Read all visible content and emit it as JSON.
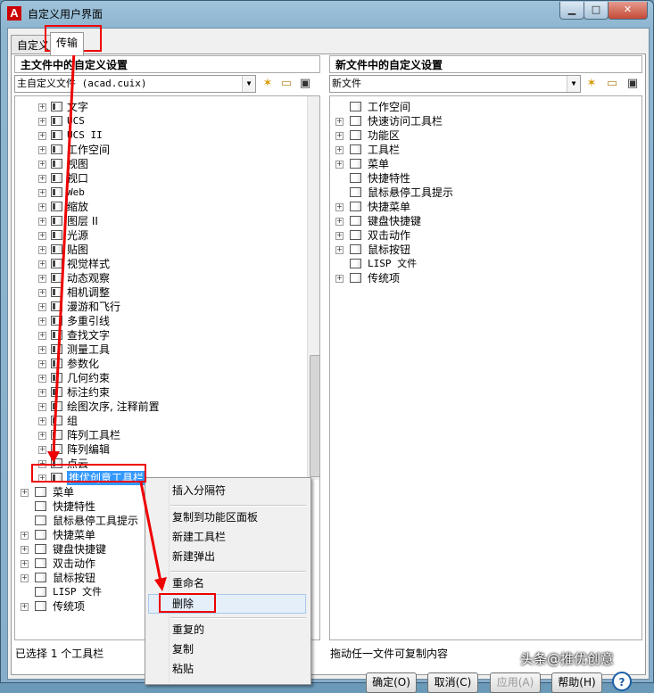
{
  "window": {
    "title": "自定义用户界面",
    "app_icon": "A",
    "minimize": "▁",
    "maximize": "□",
    "close": "✕"
  },
  "tabs": [
    "自定义",
    "传输"
  ],
  "left": {
    "header": "主文件中的自定义设置",
    "combo": "主自定义文件 (acad.cuix)",
    "tree": [
      {
        "label": "文字",
        "mono": false
      },
      {
        "label": "UCS",
        "mono": true
      },
      {
        "label": "UCS II",
        "mono": true
      },
      {
        "label": "工作空间",
        "mono": false
      },
      {
        "label": "视图",
        "mono": false
      },
      {
        "label": "视口",
        "mono": false
      },
      {
        "label": "Web",
        "mono": true
      },
      {
        "label": "缩放",
        "mono": false
      },
      {
        "label": "图层 II",
        "mono": false
      },
      {
        "label": "光源",
        "mono": false
      },
      {
        "label": "贴图",
        "mono": false
      },
      {
        "label": "视觉样式",
        "mono": false
      },
      {
        "label": "动态观察",
        "mono": false
      },
      {
        "label": "相机调整",
        "mono": false
      },
      {
        "label": "漫游和飞行",
        "mono": false
      },
      {
        "label": "多重引线",
        "mono": false
      },
      {
        "label": "查找文字",
        "mono": false
      },
      {
        "label": "测量工具",
        "mono": false
      },
      {
        "label": "参数化",
        "mono": false
      },
      {
        "label": "几何约束",
        "mono": false
      },
      {
        "label": "标注约束",
        "mono": false
      },
      {
        "label": "绘图次序, 注释前置",
        "mono": false
      },
      {
        "label": "组",
        "mono": false
      },
      {
        "label": "阵列工具栏",
        "mono": false
      },
      {
        "label": "阵列编辑",
        "mono": false
      },
      {
        "label": "点云",
        "mono": false
      },
      {
        "label": "推优创意工具栏",
        "mono": false,
        "selected": true
      }
    ],
    "tree_root": [
      {
        "label": "菜单",
        "icon": "menu-icon",
        "expander": true
      },
      {
        "label": "快捷特性",
        "icon": "quick-properties-icon",
        "expander": false
      },
      {
        "label": "鼠标悬停工具提示",
        "icon": "rollover-tooltip-icon",
        "expander": false
      },
      {
        "label": "快捷菜单",
        "icon": "shortcut-menu-icon",
        "expander": true
      },
      {
        "label": "键盘快捷键",
        "icon": "keyboard-icon",
        "expander": true
      },
      {
        "label": "双击动作",
        "icon": "double-click-icon",
        "expander": true
      },
      {
        "label": "鼠标按钮",
        "icon": "mouse-icon",
        "expander": true
      },
      {
        "label": "LISP 文件",
        "icon": "lisp-icon",
        "expander": false
      },
      {
        "label": "传统项",
        "icon": "legacy-icon",
        "expander": true
      }
    ],
    "status": "已选择 1 个工具栏"
  },
  "right": {
    "header": "新文件中的自定义设置",
    "combo": "新文件",
    "tree": [
      {
        "label": "工作空间",
        "icon": "gear-icon",
        "expander": false
      },
      {
        "label": "快速访问工具栏",
        "icon": "qat-icon",
        "expander": true
      },
      {
        "label": "功能区",
        "icon": "ribbon-icon",
        "expander": true
      },
      {
        "label": "工具栏",
        "icon": "toolbar-icon",
        "expander": true
      },
      {
        "label": "菜单",
        "icon": "menu-icon",
        "expander": true
      },
      {
        "label": "快捷特性",
        "icon": "quick-properties-icon",
        "expander": false
      },
      {
        "label": "鼠标悬停工具提示",
        "icon": "rollover-tooltip-icon",
        "expander": false
      },
      {
        "label": "快捷菜单",
        "icon": "shortcut-menu-icon",
        "expander": true
      },
      {
        "label": "键盘快捷键",
        "icon": "keyboard-icon",
        "expander": true
      },
      {
        "label": "双击动作",
        "icon": "double-click-icon",
        "expander": true
      },
      {
        "label": "鼠标按钮",
        "icon": "mouse-icon",
        "expander": true
      },
      {
        "label": "LISP 文件",
        "icon": "lisp-icon",
        "expander": false
      },
      {
        "label": "传统项",
        "icon": "legacy-icon",
        "expander": true
      }
    ],
    "status": "拖动任一文件可复制内容"
  },
  "context_menu": [
    "插入分隔符",
    "复制到功能区面板",
    "新建工具栏",
    "新建弹出",
    "重命名",
    "删除",
    "重复的",
    "复制",
    "粘贴"
  ],
  "buttons": {
    "ok": "确定(O)",
    "cancel": "取消(C)",
    "apply": "应用(A)",
    "help": "帮助(H)"
  },
  "watermark": "头条@推优创意",
  "colors": {
    "selection": "#3399ff",
    "highlight_red": "#e00000"
  }
}
